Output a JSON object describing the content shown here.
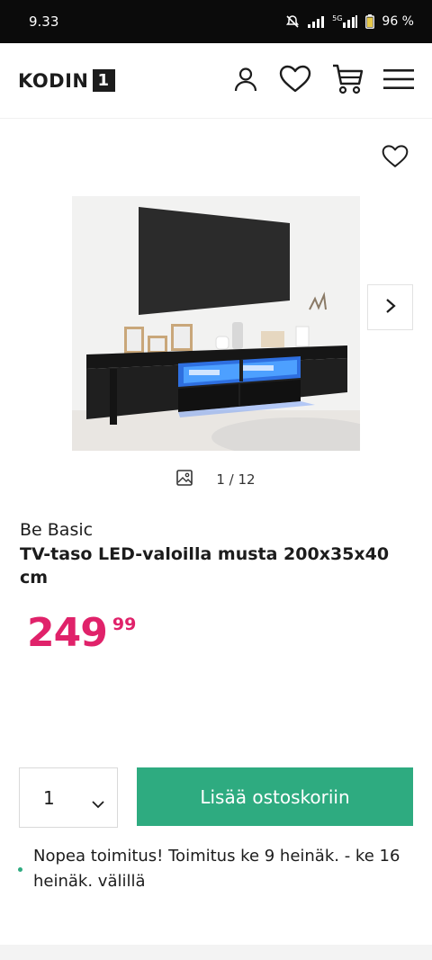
{
  "status_bar": {
    "time": "9.33",
    "network": "5G",
    "battery": "96 %"
  },
  "header": {
    "logo_text": "KODIN",
    "logo_box": "1",
    "icons": [
      "account-icon",
      "heart-icon",
      "cart-icon",
      "menu-icon"
    ]
  },
  "gallery": {
    "counter": "1 / 12",
    "counter_icon": "image-icon"
  },
  "product": {
    "brand": "Be Basic",
    "title": "TV-taso LED-valoilla musta 200x35x40 cm",
    "price_main": "249",
    "price_cents": "99",
    "price_color": "#e0226a"
  },
  "purchase": {
    "quantity": "1",
    "add_to_cart": "Lisää ostoskoriin",
    "button_color": "#2eab80"
  },
  "delivery": {
    "text": "Nopea toimitus! Toimitus ke 9 heinäk. - ke 16 heinäk. välillä"
  }
}
